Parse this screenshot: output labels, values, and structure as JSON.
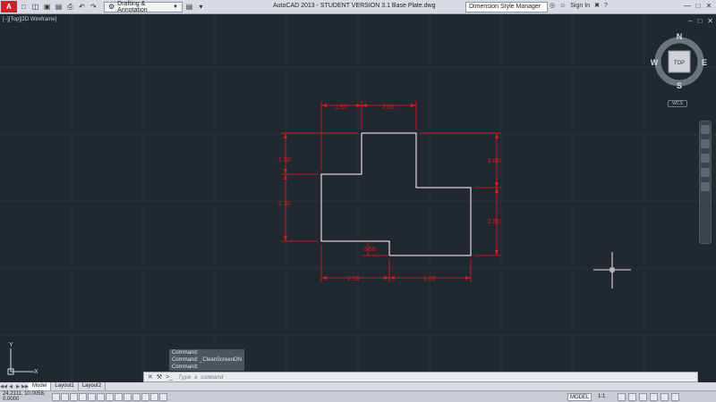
{
  "titlebar": {
    "app_logo": "A",
    "workspace": "Drafting & Annotation",
    "title": "AutoCAD 2013 - STUDENT VERSION     3.1 Base Plate.dwg",
    "search_value": "Dimension Style Manager",
    "sign_in": "Sign In",
    "quick_access_icons": [
      "new-icon",
      "open-icon",
      "save-icon",
      "save-as-icon",
      "print-icon",
      "undo-icon",
      "redo-icon"
    ],
    "window_controls": [
      "minimize-icon",
      "maximize-icon",
      "close-icon"
    ]
  },
  "viewport": {
    "label": "[−][Top][2D Wireframe]"
  },
  "viewcube": {
    "north": "N",
    "south": "S",
    "east": "E",
    "west": "W",
    "face": "TOP",
    "wcs": "WCS"
  },
  "dimensions": {
    "top_left": "1.50",
    "top_right": "2.00",
    "left_upper": "1.50",
    "left_lower": "2.50",
    "right_upper": "2.00",
    "right_lower": "2.50",
    "notch": "0.50",
    "bottom_left": "2.50",
    "bottom_right": "1.60"
  },
  "command_history": [
    "Command:",
    "Command: _CleanScreenON",
    "Command:"
  ],
  "command_input": {
    "placeholder": "Type a command"
  },
  "tabs": [
    "Model",
    "Layout1",
    "Layout2"
  ],
  "status": {
    "coords": "24.2111, 10.0058, 0.0000",
    "model": "MODEL",
    "scale": "1:1"
  },
  "ucs": {
    "x": "X",
    "y": "Y"
  },
  "colors": {
    "background": "#212830",
    "geometry": "#ffffff",
    "dimension": "#e8141a",
    "grid": "#2a323c"
  }
}
